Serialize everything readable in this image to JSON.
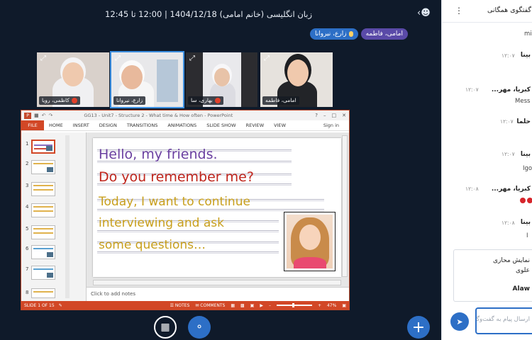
{
  "session": {
    "title": "زبان انگلیسی (خانم امامی) 1404/12/18 | 12:00 تا 12:45"
  },
  "presenters": [
    {
      "name": "زارع، نیروانا",
      "color": "#2d6fc6"
    },
    {
      "name": "امامی، فاطمه",
      "color": "#5a4aa8"
    }
  ],
  "webcams": [
    {
      "name": "کاظمی، رویا"
    },
    {
      "name": "زارع، نیروانا"
    },
    {
      "name": "بهاری، سا"
    },
    {
      "name": "امامی، فاطمه"
    }
  ],
  "presentation": {
    "window_title": "GG13 - Unit7 - Structure 2 - What time & How often - PowerPoint",
    "ribbon_tabs": [
      "FILE",
      "HOME",
      "INSERT",
      "DESIGN",
      "TRANSITIONS",
      "ANIMATIONS",
      "SLIDE SHOW",
      "REVIEW",
      "VIEW"
    ],
    "sign_in": "Sign in",
    "thumb_numbers": [
      "1",
      "2",
      "3",
      "4",
      "5",
      "6",
      "7",
      "8"
    ],
    "slide_lines": [
      "Hello, my friends.",
      "Do you remember me?",
      "Today, I want to continue",
      "interviewing and ask",
      "some questions…"
    ],
    "notes_placeholder": "Click to add notes",
    "status": {
      "slide_counter": "SLIDE 1 OF 15",
      "notes": "NOTES",
      "comments": "COMMENTS",
      "zoom": "47%"
    }
  },
  "colors": {
    "accent": "#2d6fc6",
    "powerpoint": "#d24726",
    "background": "#0f1a2a"
  },
  "chat": {
    "title": "گفتگوی همگانی",
    "messages": [
      {
        "name": "",
        "time": "",
        "body": "mis"
      },
      {
        "name": "بینا",
        "time": "۱۲:۰۷",
        "body": ""
      },
      {
        "name": "کبریا، مهر...",
        "time": "۱۲:۰۷",
        "body": "Mess"
      },
      {
        "name": "حلما",
        "time": "۱۲:۰۷",
        "body": ""
      },
      {
        "name": "بینا",
        "time": "۱۲:۰۷",
        "body": "Igo"
      },
      {
        "name": "کبریا، مهر...",
        "time": "۱۲:۰۸",
        "body": ""
      },
      {
        "name": "بینا",
        "time": "۱۲:۰۸",
        "body": "I"
      }
    ],
    "poll": {
      "line1": "نمایش محاری",
      "line2": "علوی",
      "line3": "Alaw"
    },
    "input_placeholder": "ارسال پیام به گفت‌وگوی"
  },
  "icons": {
    "user_toggle": "users-icon",
    "expand": "expand-icon",
    "camera_off": "camera-off-icon",
    "audio": "headphones-icon",
    "actions": "plus-icon",
    "send": "send-icon",
    "menu": "kebab-icon"
  }
}
